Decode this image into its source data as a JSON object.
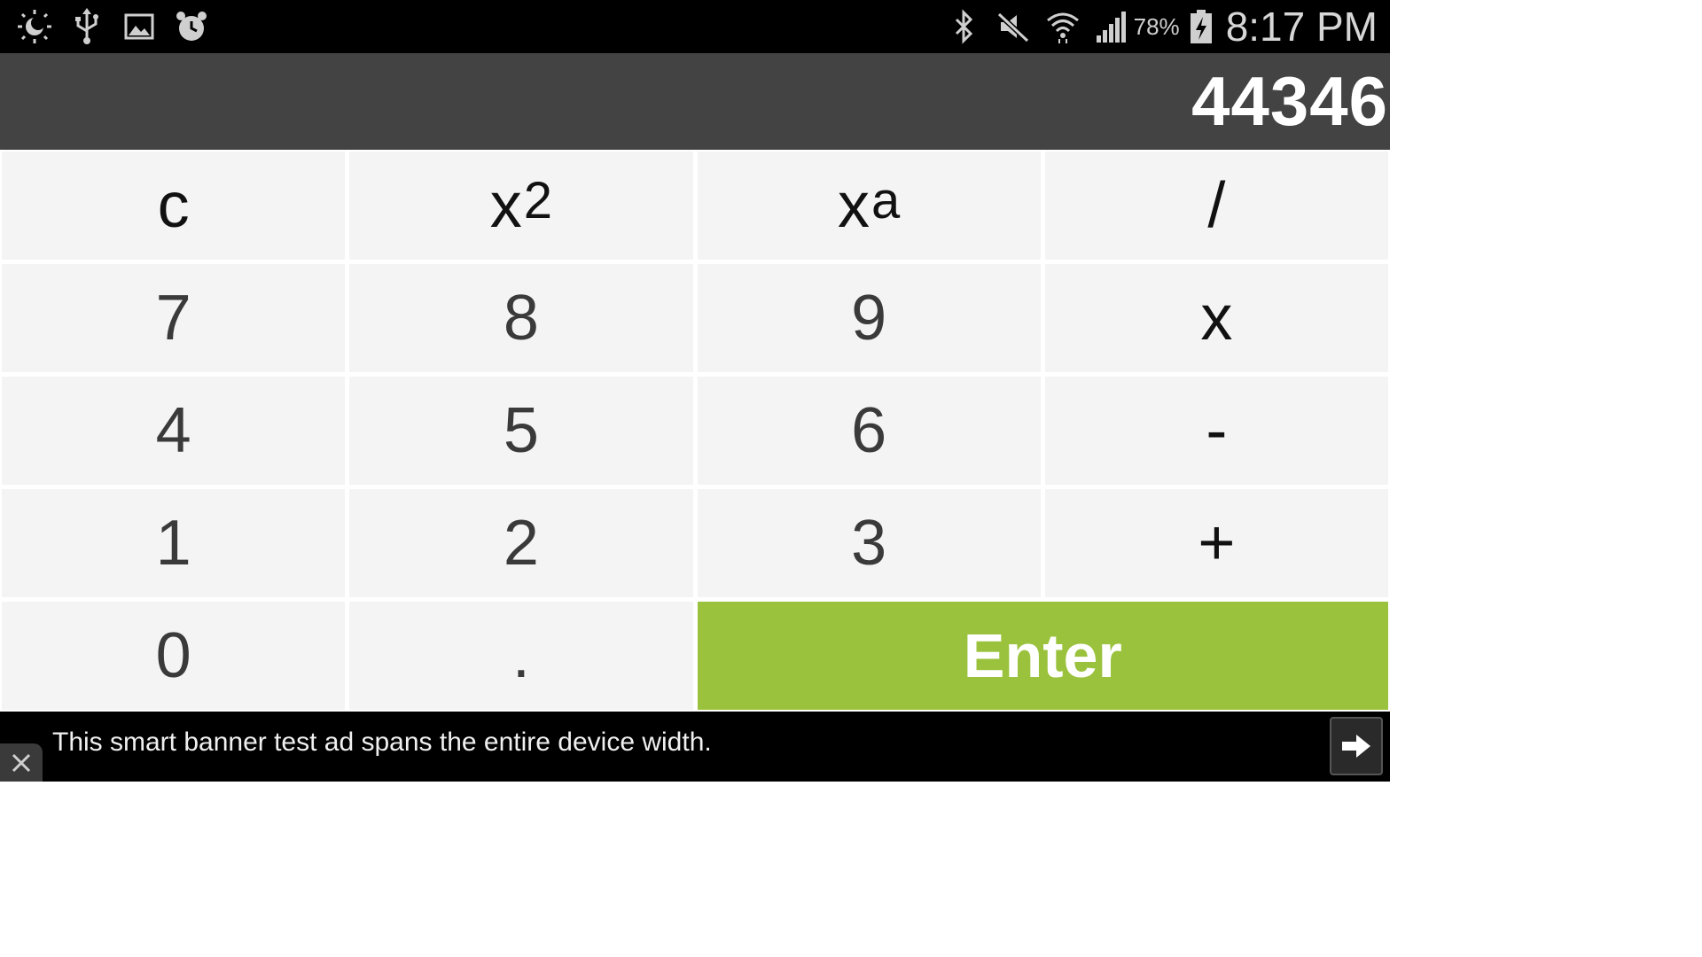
{
  "status_bar": {
    "left_icons": [
      "brightness-icon",
      "usb-icon",
      "gallery-icon",
      "alarm-icon"
    ],
    "right_icons": [
      "bluetooth-icon",
      "mute-icon",
      "wifi-icon",
      "signal-icon"
    ],
    "battery_percent": "78%",
    "battery_icon": "battery-charging-icon",
    "time": "8:17 PM"
  },
  "display": {
    "value": "44346"
  },
  "keypad": {
    "clear": "c",
    "square_base": "x",
    "square_exp": "2",
    "power_base": "x",
    "power_exp": "a",
    "divide": "/",
    "seven": "7",
    "eight": "8",
    "nine": "9",
    "multiply": "x",
    "four": "4",
    "five": "5",
    "six": "6",
    "minus": "-",
    "one": "1",
    "two": "2",
    "three": "3",
    "plus": "+",
    "zero": "0",
    "decimal": ".",
    "enter": "Enter"
  },
  "banner": {
    "text": "This smart banner test ad spans the entire device width.",
    "close_icon": "close-icon",
    "arrow_icon": "arrow-right-icon"
  },
  "colors": {
    "status_bar_bg": "#000000",
    "display_bg": "#434343",
    "key_bg": "#f4f4f4",
    "enter_bg": "#9bc23d",
    "banner_bg": "#000000"
  }
}
